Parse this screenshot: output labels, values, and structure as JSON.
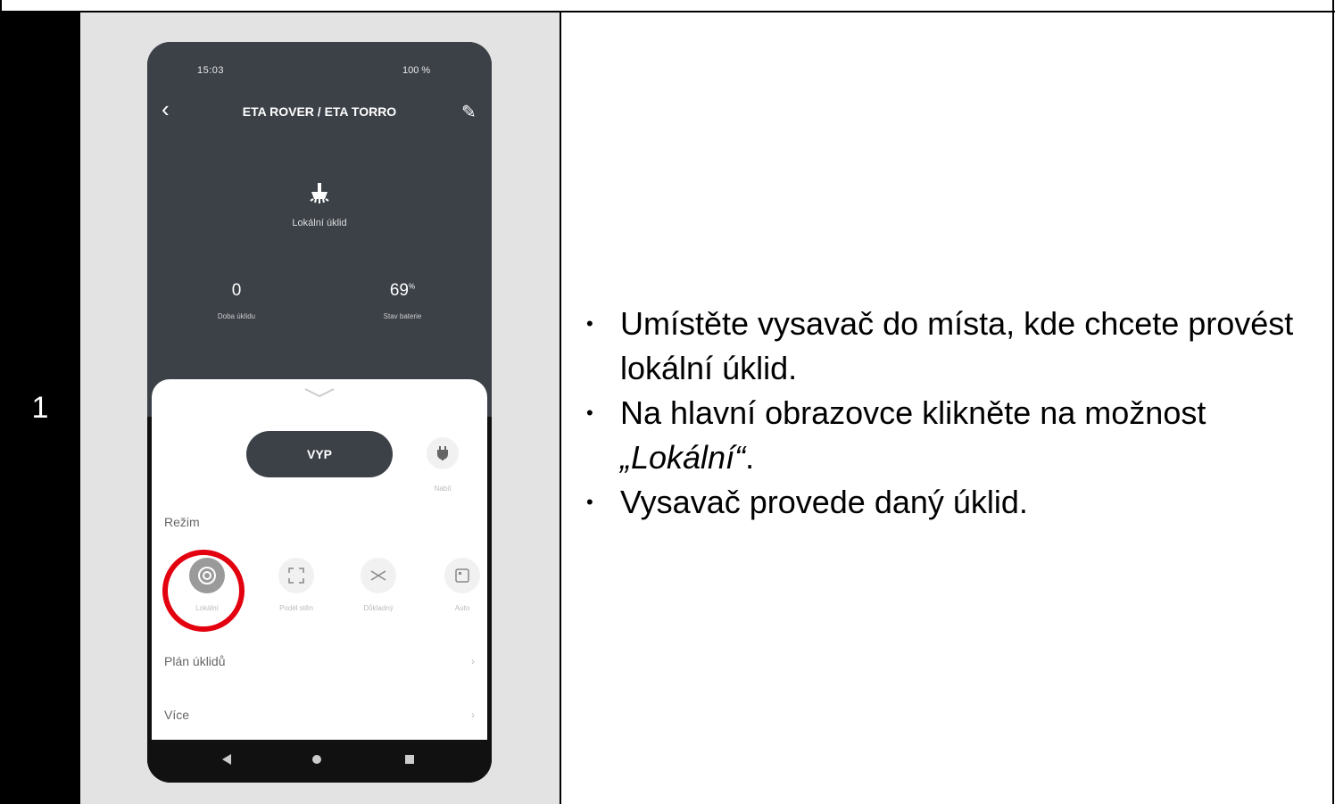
{
  "step": {
    "number": "1"
  },
  "phone": {
    "status_time": "15:03",
    "status_right": "100 %",
    "title": "ETA ROVER / ETA TORRO",
    "current_mode": "Lokální úklid",
    "stats": [
      {
        "value": "0",
        "unit": "",
        "label": "Doba úklidu"
      },
      {
        "value": "69",
        "unit": "%",
        "label": "Stav baterie"
      }
    ],
    "power_button": "VYP",
    "charge_label": "Nabít",
    "mode_section": "Režim",
    "modes": [
      {
        "label": "Lokální",
        "icon": "spot-icon",
        "active": true
      },
      {
        "label": "Podél stěn",
        "icon": "edge-icon",
        "active": false
      },
      {
        "label": "Důkladný",
        "icon": "shuffle-icon",
        "active": false
      },
      {
        "label": "Auto",
        "icon": "auto-icon",
        "active": false
      }
    ],
    "rows": [
      {
        "label": "Plán úklidů"
      },
      {
        "label": "Více"
      }
    ]
  },
  "instructions": {
    "items": [
      {
        "text": "Umístěte vysavač do místa, kde chcete provést lokální úklid."
      },
      {
        "prefix": "Na hlavní obrazovce klikněte na možnost ",
        "italic": "„Lokální“",
        "suffix": "."
      },
      {
        "text": "Vysavač provede daný úklid."
      }
    ]
  },
  "colors": {
    "highlight": "#e3000f",
    "app_dark": "#3c4148"
  }
}
